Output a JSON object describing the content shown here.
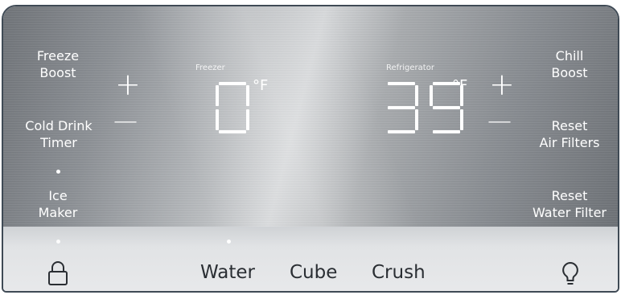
{
  "controls": {
    "freeze_boost": "Freeze\nBoost",
    "cold_drink_timer": "Cold Drink\nTimer",
    "ice_maker": "Ice\nMaker",
    "chill_boost": "Chill\nBoost",
    "reset_air_filters": "Reset\nAir Filters",
    "reset_water_filter": "Reset\nWater Filter"
  },
  "freezer": {
    "label": "Freezer",
    "temperature": "0",
    "unit": "°F",
    "plus": "+",
    "minus": "—"
  },
  "refrigerator": {
    "label": "Refrigerator",
    "temperature": "39",
    "unit": "°F",
    "plus": "+",
    "minus": "—"
  },
  "dispenser": {
    "water": "Water",
    "cube": "Cube",
    "crush": "Crush"
  },
  "icons": {
    "lock": "lock-icon",
    "light": "light-bulb-icon"
  },
  "indicators": {
    "ice_maker_on": true,
    "water_selected": true
  },
  "colors": {
    "text": "#ffffff",
    "bottom_text": "#2a2e33",
    "border": "#3f4a55"
  }
}
